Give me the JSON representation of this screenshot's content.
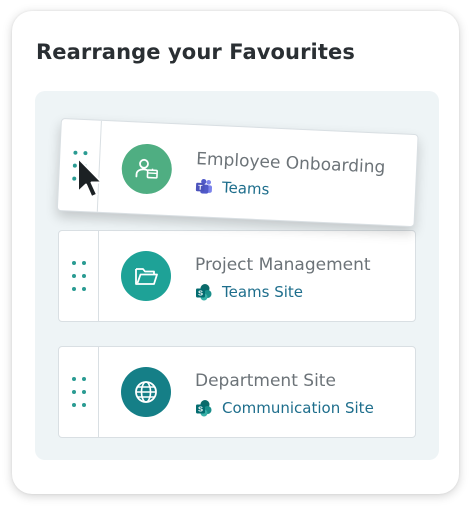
{
  "title": "Rearrange your Favourites",
  "items": [
    {
      "name": "Employee Onboarding",
      "type": "Teams",
      "icon": "user-card-icon",
      "app_icon": "teams-icon",
      "color": "#4fae82"
    },
    {
      "name": "Project Management",
      "type": "Teams Site",
      "icon": "folder-icon",
      "app_icon": "sharepoint-icon",
      "color": "#1ea297"
    },
    {
      "name": "Department Site",
      "type": "Communication Site",
      "icon": "globe-icon",
      "app_icon": "sharepoint-icon",
      "color": "#157f87"
    }
  ],
  "colors": {
    "accent_teal": "#2a9b92",
    "link_blue": "#1e6e8c",
    "panel_bg": "#eef4f6"
  }
}
